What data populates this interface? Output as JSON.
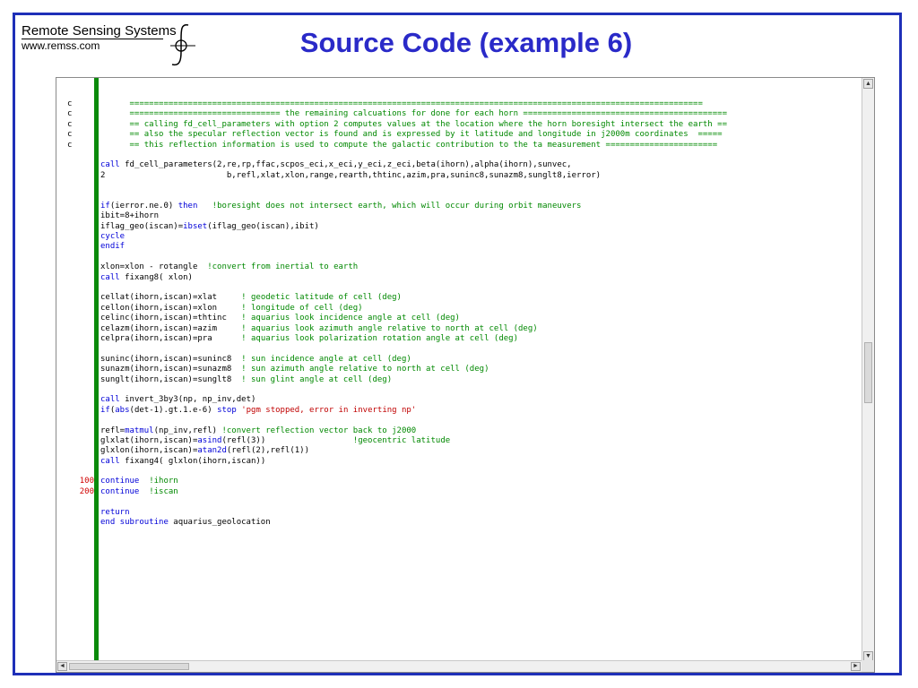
{
  "header": {
    "logo_company": "Remote Sensing Systems",
    "logo_url": "www.remss.com",
    "title": "Source Code (example 6)"
  },
  "editor": {
    "lines": [
      {
        "num": "c",
        "segments": [
          {
            "t": "      ======================================================================================================================",
            "k": "cm"
          }
        ]
      },
      {
        "num": "c",
        "segments": [
          {
            "t": "      =============================== the remaining calcuations for done for each horn ==========================================",
            "k": "cm"
          }
        ]
      },
      {
        "num": "c",
        "segments": [
          {
            "t": "      == calling fd_cell_parameters with option 2 computes values at the location where the horn boresight intersect the earth ==",
            "k": "cm"
          }
        ]
      },
      {
        "num": "c",
        "segments": [
          {
            "t": "      == also the specular reflection vector is found and is expressed by it latitude and longitude in j2000m coordinates  =====",
            "k": "cm"
          }
        ]
      },
      {
        "num": "c",
        "segments": [
          {
            "t": "      == this reflection information is used to compute the galactic contribution to the ta measurement =======================",
            "k": "cm"
          }
        ]
      },
      {
        "num": "",
        "segments": []
      },
      {
        "num": "",
        "segments": [
          {
            "t": "call",
            "k": "kw"
          },
          {
            "t": " fd_cell_parameters(2,re,rp,ffac,scpos_eci,x_eci,y_eci,z_eci,beta(ihorn),alpha(ihorn),sunvec,",
            "k": ""
          }
        ]
      },
      {
        "num": "",
        "segments": [
          {
            "t": "2                         b,refl,xlat,xlon,range,rearth,thtinc,azim,pra,suninc8,sunazm8,sunglt8,ierror)",
            "k": ""
          }
        ]
      },
      {
        "num": "",
        "segments": []
      },
      {
        "num": "",
        "segments": []
      },
      {
        "num": "",
        "segments": [
          {
            "t": "if",
            "k": "kw"
          },
          {
            "t": "(ierror.ne.0) ",
            "k": ""
          },
          {
            "t": "then",
            "k": "kw"
          },
          {
            "t": "   !boresight does not intersect earth, which will occur during orbit maneuvers",
            "k": "cm"
          }
        ]
      },
      {
        "num": "",
        "segments": [
          {
            "t": "ibit=8+ihorn",
            "k": ""
          }
        ]
      },
      {
        "num": "",
        "segments": [
          {
            "t": "iflag_geo(iscan)=",
            "k": ""
          },
          {
            "t": "ibset",
            "k": "kw"
          },
          {
            "t": "(iflag_geo(iscan),ibit)",
            "k": ""
          }
        ]
      },
      {
        "num": "",
        "segments": [
          {
            "t": "cycle",
            "k": "kw"
          }
        ]
      },
      {
        "num": "",
        "segments": [
          {
            "t": "endif",
            "k": "kw"
          }
        ]
      },
      {
        "num": "",
        "segments": []
      },
      {
        "num": "",
        "segments": [
          {
            "t": "xlon=xlon - rotangle  ",
            "k": ""
          },
          {
            "t": "!convert from inertial to earth",
            "k": "cm"
          }
        ]
      },
      {
        "num": "",
        "segments": [
          {
            "t": "call",
            "k": "kw"
          },
          {
            "t": " fixang8( xlon)",
            "k": ""
          }
        ]
      },
      {
        "num": "",
        "segments": []
      },
      {
        "num": "",
        "segments": [
          {
            "t": "cellat(ihorn,iscan)=xlat     ",
            "k": ""
          },
          {
            "t": "! geodetic latitude of cell (deg)",
            "k": "cm"
          }
        ]
      },
      {
        "num": "",
        "segments": [
          {
            "t": "cellon(ihorn,iscan)=xlon     ",
            "k": ""
          },
          {
            "t": "! longitude of cell (deg)",
            "k": "cm"
          }
        ]
      },
      {
        "num": "",
        "segments": [
          {
            "t": "celinc(ihorn,iscan)=thtinc   ",
            "k": ""
          },
          {
            "t": "! aquarius look incidence angle at cell (deg)",
            "k": "cm"
          }
        ]
      },
      {
        "num": "",
        "segments": [
          {
            "t": "celazm(ihorn,iscan)=azim     ",
            "k": ""
          },
          {
            "t": "! aquarius look azimuth angle relative to north at cell (deg)",
            "k": "cm"
          }
        ]
      },
      {
        "num": "",
        "segments": [
          {
            "t": "celpra(ihorn,iscan)=pra      ",
            "k": ""
          },
          {
            "t": "! aquarius look polarization rotation angle at cell (deg)",
            "k": "cm"
          }
        ]
      },
      {
        "num": "",
        "segments": []
      },
      {
        "num": "",
        "segments": [
          {
            "t": "suninc(ihorn,iscan)=suninc8  ",
            "k": ""
          },
          {
            "t": "! sun incidence angle at cell (deg)",
            "k": "cm"
          }
        ]
      },
      {
        "num": "",
        "segments": [
          {
            "t": "sunazm(ihorn,iscan)=sunazm8  ",
            "k": ""
          },
          {
            "t": "! sun azimuth angle relative to north at cell (deg)",
            "k": "cm"
          }
        ]
      },
      {
        "num": "",
        "segments": [
          {
            "t": "sunglt(ihorn,iscan)=sunglt8  ",
            "k": ""
          },
          {
            "t": "! sun glint angle at cell (deg)",
            "k": "cm"
          }
        ]
      },
      {
        "num": "",
        "segments": []
      },
      {
        "num": "",
        "segments": [
          {
            "t": "call",
            "k": "kw"
          },
          {
            "t": " invert_3by3(np, np_inv,det)",
            "k": ""
          }
        ]
      },
      {
        "num": "",
        "segments": [
          {
            "t": "if",
            "k": "kw"
          },
          {
            "t": "(",
            "k": ""
          },
          {
            "t": "abs",
            "k": "kw"
          },
          {
            "t": "(det-1).gt.1.e-6) ",
            "k": ""
          },
          {
            "t": "stop",
            "k": "kw"
          },
          {
            "t": " ",
            "k": ""
          },
          {
            "t": "'pgm stopped, error in inverting np'",
            "k": "st"
          }
        ]
      },
      {
        "num": "",
        "segments": []
      },
      {
        "num": "",
        "segments": [
          {
            "t": "refl=",
            "k": ""
          },
          {
            "t": "matmul",
            "k": "kw"
          },
          {
            "t": "(np_inv,refl) ",
            "k": ""
          },
          {
            "t": "!convert reflection vector back to j2000",
            "k": "cm"
          }
        ]
      },
      {
        "num": "",
        "segments": [
          {
            "t": "glxlat(ihorn,iscan)=",
            "k": ""
          },
          {
            "t": "asind",
            "k": "kw"
          },
          {
            "t": "(refl(3))                  ",
            "k": ""
          },
          {
            "t": "!geocentric latitude",
            "k": "cm"
          }
        ]
      },
      {
        "num": "",
        "segments": [
          {
            "t": "glxlon(ihorn,iscan)=",
            "k": ""
          },
          {
            "t": "atan2d",
            "k": "kw"
          },
          {
            "t": "(refl(2),refl(1))",
            "k": ""
          }
        ]
      },
      {
        "num": "",
        "segments": [
          {
            "t": "call",
            "k": "kw"
          },
          {
            "t": " fixang4( glxlon(ihorn,iscan))",
            "k": ""
          }
        ]
      },
      {
        "num": "",
        "segments": []
      },
      {
        "num": "100",
        "segments": [
          {
            "t": "continue",
            "k": "kw"
          },
          {
            "t": "  ",
            "k": ""
          },
          {
            "t": "!ihorn",
            "k": "cm"
          }
        ]
      },
      {
        "num": "200",
        "segments": [
          {
            "t": "continue",
            "k": "kw"
          },
          {
            "t": "  ",
            "k": ""
          },
          {
            "t": "!iscan",
            "k": "cm"
          }
        ]
      },
      {
        "num": "",
        "segments": []
      },
      {
        "num": "",
        "segments": [
          {
            "t": "return",
            "k": "kw"
          }
        ]
      },
      {
        "num": "",
        "segments": [
          {
            "t": "end subroutine",
            "k": "kw"
          },
          {
            "t": " aquarius_geolocation",
            "k": ""
          }
        ]
      }
    ]
  },
  "scrollbars": {
    "up_arrow": "▲",
    "down_arrow": "▼",
    "left_arrow": "◄",
    "right_arrow": "►"
  },
  "colors": {
    "frame": "#1e2fb8",
    "title": "#2a2ac8",
    "keyword": "#0000d8",
    "comment": "#008800",
    "string": "#c00000",
    "label": "#d00000",
    "green_bar": "#0a8a0a"
  }
}
